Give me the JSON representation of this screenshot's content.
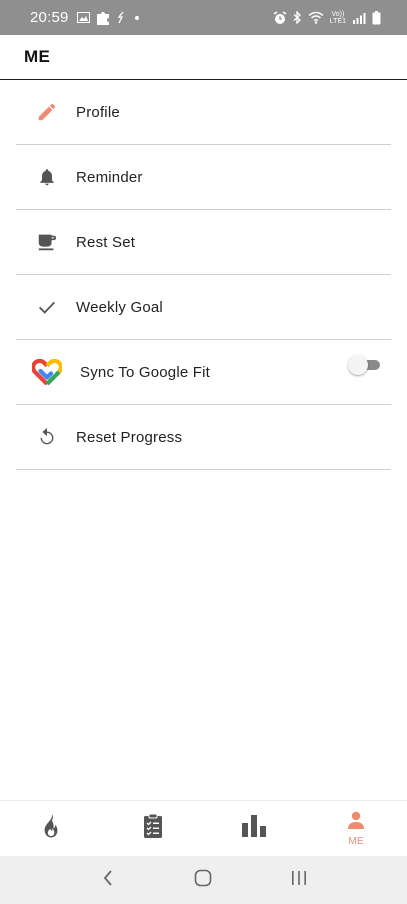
{
  "status_bar": {
    "time": "20:59",
    "carrier_text_top": "Vo))",
    "carrier_text_bottom": "LTE1"
  },
  "app_bar": {
    "title": "ME"
  },
  "menu": {
    "items": [
      {
        "label": "Profile",
        "icon": "pencil-icon"
      },
      {
        "label": "Reminder",
        "icon": "bell-icon"
      },
      {
        "label": "Rest Set",
        "icon": "coffee-cup-icon"
      },
      {
        "label": "Weekly Goal",
        "icon": "checkmark-icon"
      },
      {
        "label": "Sync To Google Fit",
        "icon": "google-fit-icon",
        "toggle_on": false
      },
      {
        "label": "Reset Progress",
        "icon": "refresh-icon"
      }
    ]
  },
  "bottom_nav": {
    "tabs": [
      {
        "icon": "flame-icon",
        "label": ""
      },
      {
        "icon": "clipboard-checklist-icon",
        "label": ""
      },
      {
        "icon": "bar-chart-icon",
        "label": ""
      },
      {
        "icon": "person-icon",
        "label": "ME",
        "active": true
      }
    ]
  },
  "colors": {
    "accent": "#f0896f",
    "icon_gray": "#555555",
    "status_bar_bg": "#8f8f8f",
    "divider": "#cfcfcf"
  }
}
